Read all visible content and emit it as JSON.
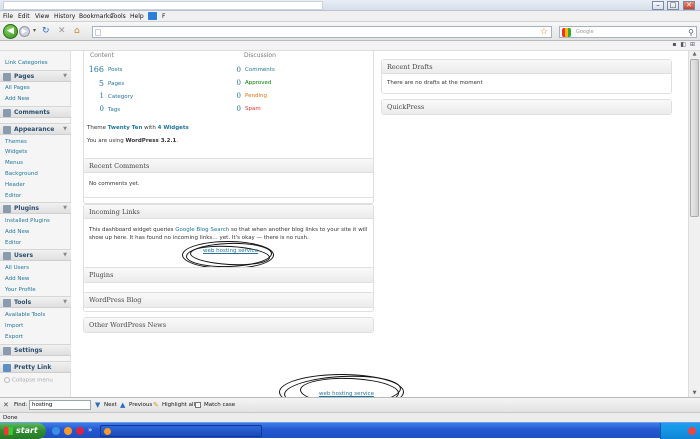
{
  "window": {
    "title": "",
    "controls": [
      "–",
      "□",
      "✕"
    ]
  },
  "menubar": {
    "items": [
      "File",
      "Edit",
      "View",
      "History",
      "Bookmarks",
      "Tools",
      "Help"
    ],
    "trailing": "F"
  },
  "navbar": {
    "url": "",
    "search_placeholder": "Google"
  },
  "sidebar": {
    "top_item": "Link Categories",
    "pages": {
      "label": "Pages",
      "items": [
        "All Pages",
        "Add New"
      ]
    },
    "comments": {
      "label": "Comments"
    },
    "appearance": {
      "label": "Appearance",
      "items": [
        "Themes",
        "Widgets",
        "Menus",
        "Background",
        "Header",
        "Editor"
      ]
    },
    "plugins": {
      "label": "Plugins",
      "items": [
        "Installed Plugins",
        "Add New",
        "Editor"
      ]
    },
    "users": {
      "label": "Users",
      "items": [
        "All Users",
        "Add New",
        "Your Profile"
      ]
    },
    "tools": {
      "label": "Tools",
      "items": [
        "Available Tools",
        "Import",
        "Export"
      ]
    },
    "settings": {
      "label": "Settings"
    },
    "pretty_link": {
      "label": "Pretty Link"
    },
    "collapse": "Collapse menu"
  },
  "right_now": {
    "content_title": "Content",
    "discussion_title": "Discussion",
    "content": [
      {
        "num": "166",
        "label": "Posts"
      },
      {
        "num": "5",
        "label": "Pages"
      },
      {
        "num": "1",
        "label": "Category"
      },
      {
        "num": "0",
        "label": "Tags"
      }
    ],
    "discussion": [
      {
        "num": "0",
        "label": "Comments",
        "color": "#21759b"
      },
      {
        "num": "0",
        "label": "Approved",
        "color": "#008000"
      },
      {
        "num": "0",
        "label": "Pending",
        "color": "#e66f00"
      },
      {
        "num": "0",
        "label": "Spam",
        "color": "#dd3333"
      }
    ],
    "theme_prefix": "Theme",
    "theme_name": "Twenty Ten",
    "theme_with": "with",
    "widgets": "4 Widgets",
    "version_prefix": "You are using",
    "version": "WordPress 3.2.1",
    "version_suffix": "."
  },
  "recent_comments": {
    "title": "Recent Comments",
    "text": "No comments yet."
  },
  "incoming_links": {
    "title": "Incoming Links",
    "text_before": "This dashboard widget queries",
    "link": "Google Blog Search",
    "text_after_1": "so that when another blog links to your site it will",
    "text_after_2": "show up here. It has found no incoming links… yet. It's okay — there is no rush.",
    "annotation": "web hosting service"
  },
  "plugins_box": {
    "title": "Plugins"
  },
  "wp_blog": {
    "title": "WordPress Blog"
  },
  "other_news": {
    "title": "Other WordPress News"
  },
  "recent_drafts": {
    "title": "Recent Drafts",
    "text": "There are no drafts at the moment"
  },
  "quickpress": {
    "title": "QuickPress"
  },
  "footer_annotation": "web hosting service",
  "findbar": {
    "find_label": "Find:",
    "query": "hosting",
    "next": "Next",
    "previous": "Previous",
    "highlight": "Highlight all",
    "match_case": "Match case"
  },
  "statusbar": {
    "text": "Done"
  },
  "taskbar": {
    "start": "start"
  }
}
